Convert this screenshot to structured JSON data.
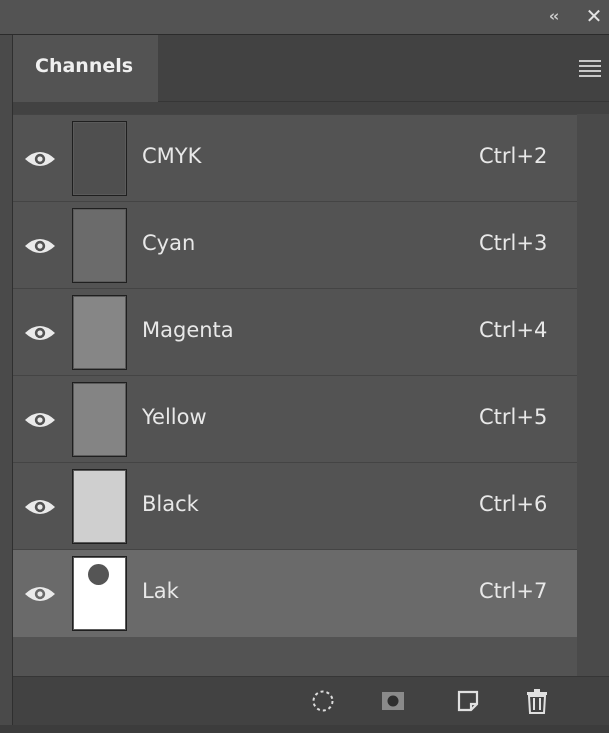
{
  "window": {
    "collapse_glyph": "‹‹",
    "close_glyph": "✕"
  },
  "panel": {
    "tab_label": "Channels",
    "menu_icon": "panel-menu-icon"
  },
  "channels": [
    {
      "name": "CMYK",
      "shortcut": "Ctrl+2",
      "thumb_color": "#4f4f4f",
      "visible": true,
      "selected": false
    },
    {
      "name": "Cyan",
      "shortcut": "Ctrl+3",
      "thumb_color": "#6b6b6b",
      "visible": true,
      "selected": false
    },
    {
      "name": "Magenta",
      "shortcut": "Ctrl+4",
      "thumb_color": "#868686",
      "visible": true,
      "selected": false
    },
    {
      "name": "Yellow",
      "shortcut": "Ctrl+5",
      "thumb_color": "#848484",
      "visible": true,
      "selected": false
    },
    {
      "name": "Black",
      "shortcut": "Ctrl+6",
      "thumb_color": "#cfcfcf",
      "visible": true,
      "selected": false
    },
    {
      "name": "Lak",
      "shortcut": "Ctrl+7",
      "thumb_color": "#ffffff",
      "visible": true,
      "selected": true
    }
  ],
  "toolbar": {
    "buttons": [
      {
        "name": "load-channel-as-selection",
        "icon": "dotted-circle-icon"
      },
      {
        "name": "save-selection-as-channel",
        "icon": "mask-icon"
      },
      {
        "name": "create-new-channel",
        "icon": "new-page-icon"
      },
      {
        "name": "delete-channel",
        "icon": "trash-icon"
      }
    ]
  },
  "colors": {
    "panel_bg": "#535353",
    "selected_row": "#6a6a6a",
    "text": "#e8e8e8"
  }
}
